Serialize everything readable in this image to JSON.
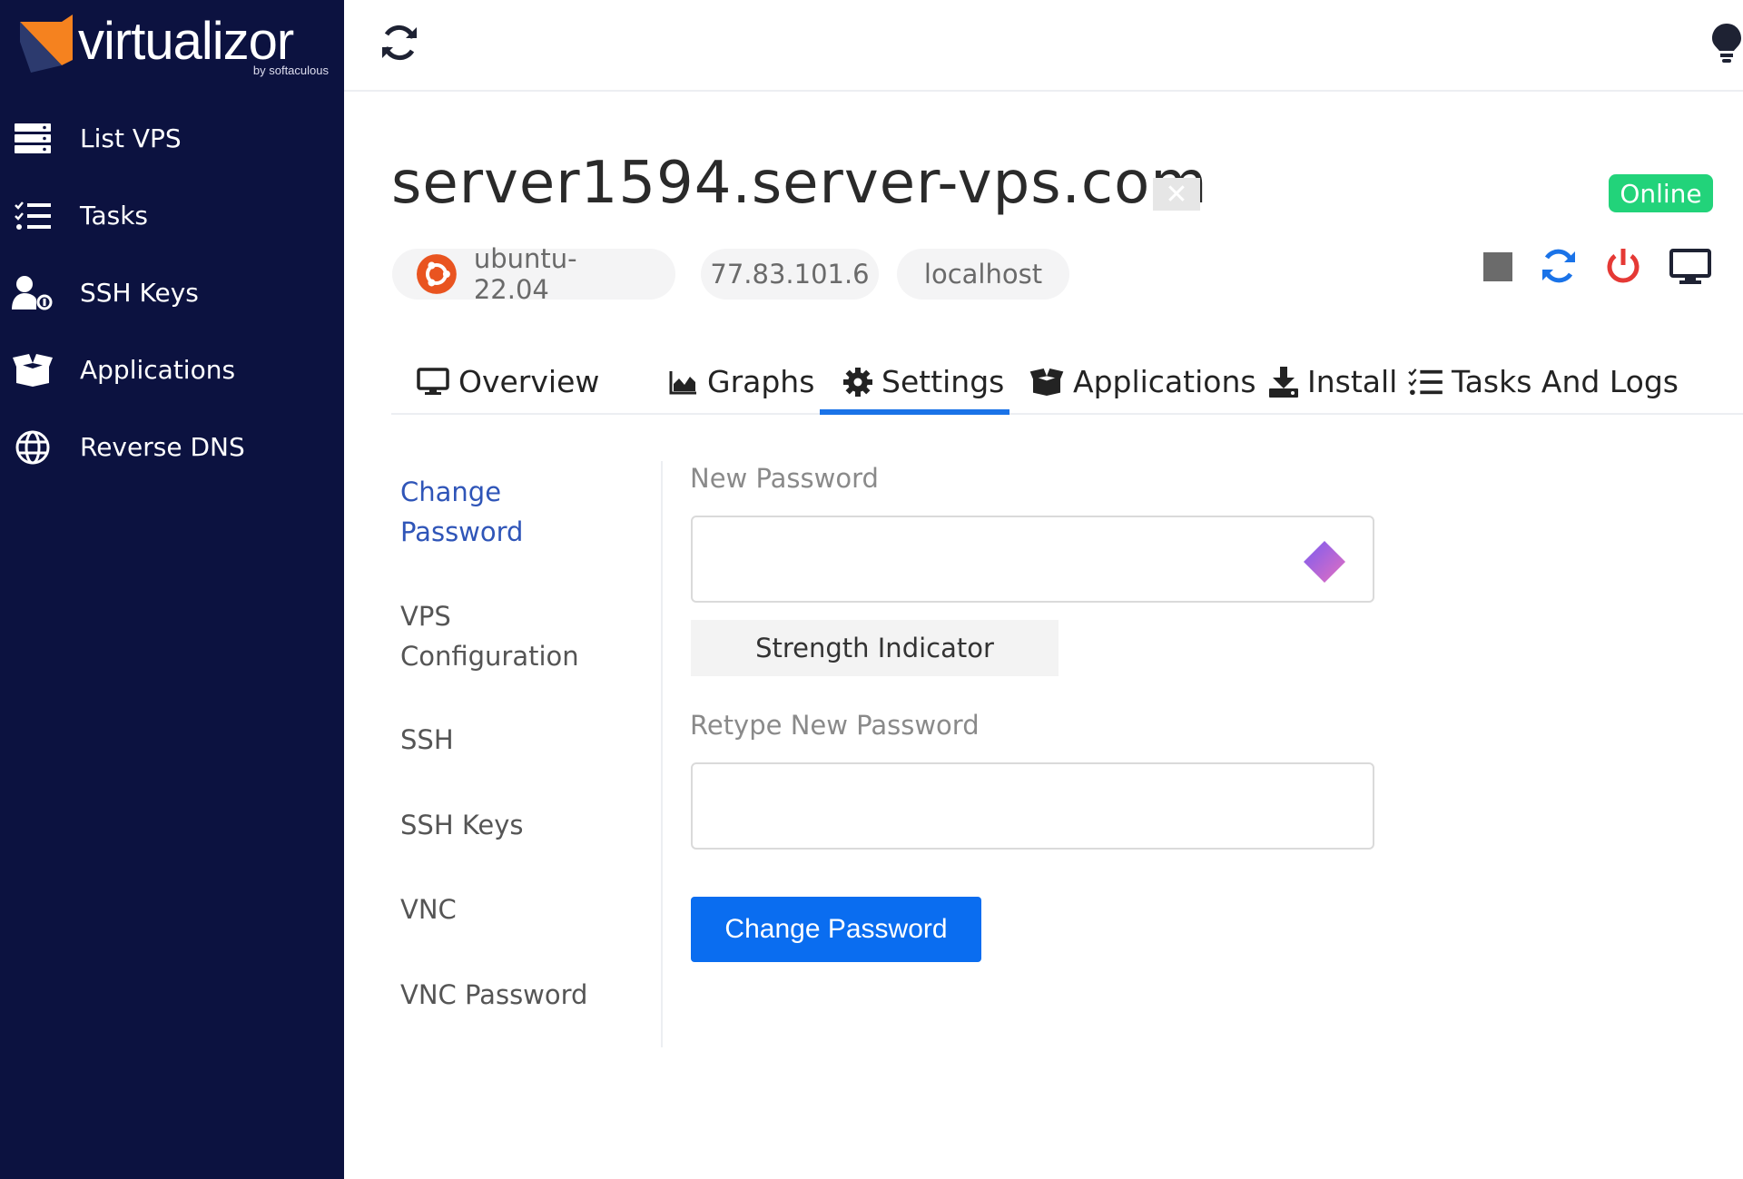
{
  "brand": {
    "name": "virtualizor",
    "sub": "by softaculous"
  },
  "sidebar": {
    "items": [
      {
        "label": "List VPS",
        "icon": "server-list-icon"
      },
      {
        "label": "Tasks",
        "icon": "tasks-icon"
      },
      {
        "label": "SSH Keys",
        "icon": "user-key-icon"
      },
      {
        "label": "Applications",
        "icon": "box-icon"
      },
      {
        "label": "Reverse DNS",
        "icon": "globe-icon"
      }
    ]
  },
  "vps": {
    "hostname": "server1594.server-vps.com",
    "status": "Online",
    "os": "ubuntu-22.04",
    "ip": "77.83.101.6",
    "host": "localhost"
  },
  "tabs": [
    {
      "label": "Overview",
      "icon": "monitor-icon"
    },
    {
      "label": "Graphs",
      "icon": "area-chart-icon"
    },
    {
      "label": "Settings",
      "icon": "gear-icon",
      "active": true
    },
    {
      "label": "Applications",
      "icon": "box-icon"
    },
    {
      "label": "Install",
      "icon": "download-icon"
    },
    {
      "label": "Tasks And Logs",
      "icon": "tasks-icon"
    }
  ],
  "settings_nav": {
    "change_password_1": "Change",
    "change_password_2": "Password",
    "vps_config_1": "VPS",
    "vps_config_2": "Configuration",
    "ssh": "SSH",
    "ssh_keys": "SSH Keys",
    "vnc": "VNC",
    "vnc_password": "VNC Password"
  },
  "form": {
    "new_password_label": "New Password",
    "new_password_value": "",
    "strength_indicator": "Strength Indicator",
    "retype_label": "Retype New Password",
    "retype_value": "",
    "submit_label": "Change Password"
  },
  "colors": {
    "sidebar_bg": "#0c1240",
    "accent": "#1a73e8",
    "online": "#22d37a",
    "danger": "#e53935"
  }
}
